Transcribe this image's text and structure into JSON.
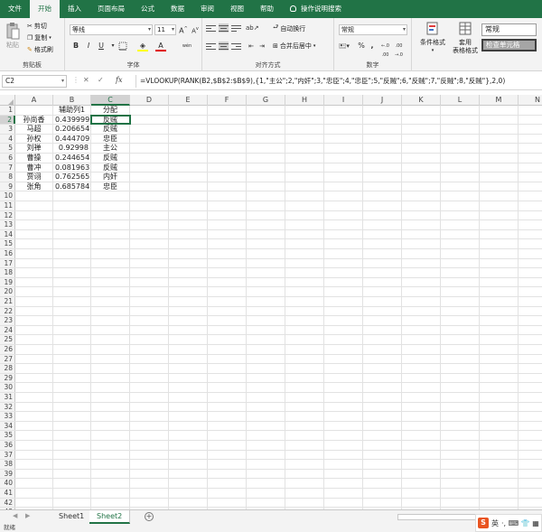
{
  "tabs": [
    "文件",
    "开始",
    "插入",
    "页面布局",
    "公式",
    "数据",
    "审阅",
    "视图",
    "帮助"
  ],
  "tell_me": "操作说明搜索",
  "ribbon": {
    "clipboard": {
      "paste": "粘贴",
      "cut": "剪切",
      "copy": "复制",
      "format_painter": "格式刷",
      "label": "剪贴板"
    },
    "font": {
      "name": "等线",
      "size": "11",
      "grow": "A",
      "shrink": "A",
      "bold": "B",
      "italic": "I",
      "underline": "U",
      "font_color_glyph": "A",
      "wen": "wén",
      "label": "字体"
    },
    "alignment": {
      "wrap": "自动换行",
      "merge": "合并后居中",
      "label": "对齐方式"
    },
    "number": {
      "format": "常规",
      "percent": "%",
      "comma": ",",
      "label": "数字"
    },
    "styles": {
      "conditional": "条件格式",
      "table": "套用",
      "table2": "表格格式",
      "normal": "常规",
      "check": "检查单元格"
    }
  },
  "name_box": "C2",
  "formula": "=VLOOKUP(RANK(B2,$B$2:$B$9),{1,\"主公\";2,\"内奸\";3,\"忠臣\";4,\"忠臣\";5,\"反贼\";6,\"反贼\";7,\"反贼\";8,\"反贼\"},2,0)",
  "columns": [
    "A",
    "B",
    "C",
    "D",
    "E",
    "F",
    "G",
    "H",
    "I",
    "J",
    "K",
    "L",
    "M",
    "N"
  ],
  "rows": [
    [
      "",
      "辅助列1",
      "分配"
    ],
    [
      "孙尚香",
      "0.439999",
      "反贼"
    ],
    [
      "马超",
      "0.206654",
      "反贼"
    ],
    [
      "孙权",
      "0.444709",
      "忠臣"
    ],
    [
      "刘禅",
      "0.92998",
      "主公"
    ],
    [
      "曹操",
      "0.244654",
      "反贼"
    ],
    [
      "曹冲",
      "0.081963",
      "反贼"
    ],
    [
      "贾诩",
      "0.762565",
      "内奸"
    ],
    [
      "张角",
      "0.685784",
      "忠臣"
    ]
  ],
  "sheets": [
    "Sheet1",
    "Sheet2"
  ],
  "add_sheet": "+",
  "status": "就绪",
  "ime": {
    "logo": "S",
    "lang": "英",
    "extra": "·, ⌨ 👕 ▦"
  }
}
